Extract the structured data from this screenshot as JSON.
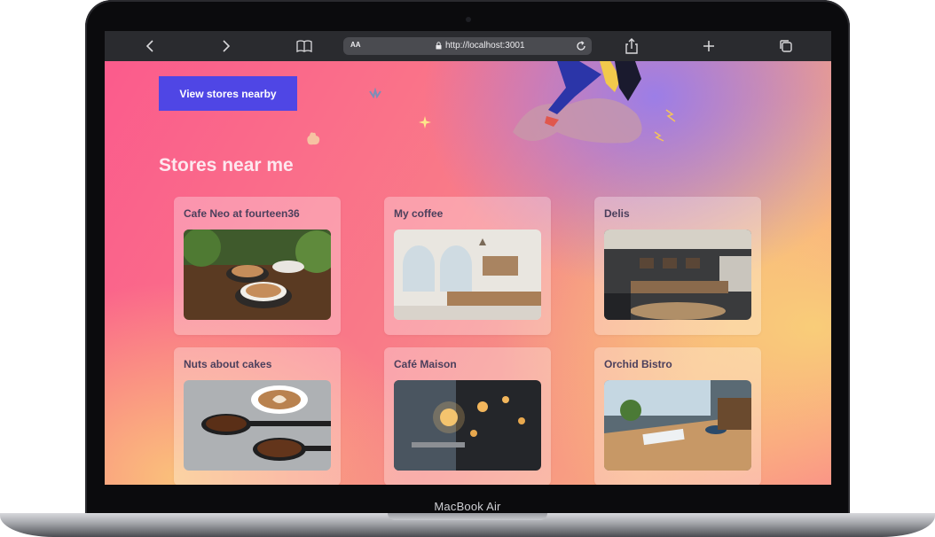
{
  "device": {
    "model_label": "MacBook Air"
  },
  "browser": {
    "url_text": "http://localhost:3001",
    "text_size_label": "AA",
    "icons": [
      "back-icon",
      "forward-icon",
      "book-icon",
      "lock-icon",
      "reload-icon",
      "share-icon",
      "plus-icon",
      "tabs-icon"
    ]
  },
  "page": {
    "cta_label": "View stores nearby",
    "section_title": "Stores near me",
    "stores": [
      {
        "name": "Cafe Neo at fourteen36"
      },
      {
        "name": "My coffee"
      },
      {
        "name": "Delis"
      },
      {
        "name": "Nuts about cakes"
      },
      {
        "name": "Café Maison"
      },
      {
        "name": "Orchid Bistro"
      }
    ]
  },
  "colors": {
    "accent": "#4f46e5",
    "gradient_pink": "#fb5b8c",
    "gradient_purple": "#977dec",
    "gradient_yellow": "#f9d078"
  }
}
